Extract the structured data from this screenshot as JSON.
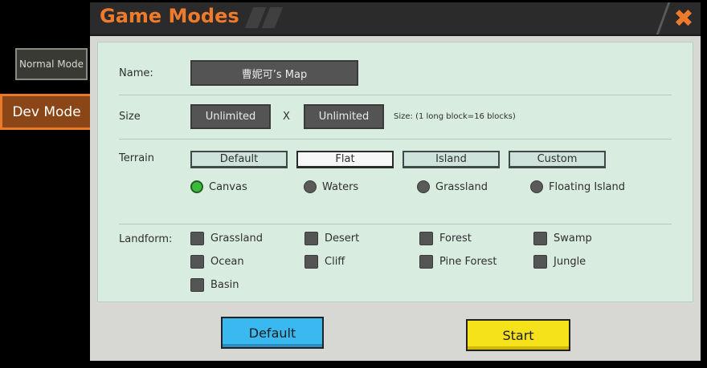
{
  "sidebar": {
    "normal_mode": "Normal Mode",
    "dev_mode": "Dev Mode"
  },
  "dialog": {
    "title": "Game Modes",
    "close_glyph": "✖"
  },
  "form": {
    "name_label": "Name:",
    "name_value": "曹妮可’s Map",
    "size_label": "Size",
    "size_width": "Unlimited",
    "size_x": "X",
    "size_height": "Unlimited",
    "size_note": "Size: (1 long block=16 blocks)",
    "terrain_label": "Terrain",
    "terrain_buttons": [
      "Default",
      "Flat",
      "Island",
      "Custom"
    ],
    "terrain_selected": "Flat",
    "terrain_options": [
      "Canvas",
      "Waters",
      "Grassland",
      "Floating Island"
    ],
    "terrain_option_selected": "Canvas",
    "landform_label": "Landform:",
    "landforms": [
      "Grassland",
      "Desert",
      "Forest",
      "Swamp",
      "Ocean",
      "Cliff",
      "Pine Forest",
      "Jungle",
      "Basin"
    ]
  },
  "footer": {
    "default_label": "Default",
    "start_label": "Start"
  },
  "colors": {
    "accent": "#ee7a2c",
    "panel": "#d9ece0",
    "default_button": "#3ab9f0",
    "start_button": "#f6e21a",
    "selected_radio": "#3cba3c"
  }
}
